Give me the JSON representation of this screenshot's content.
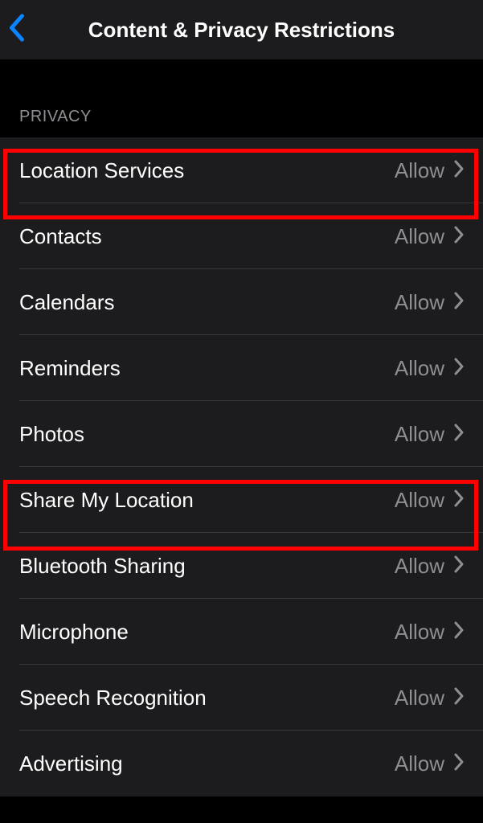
{
  "header": {
    "title": "Content & Privacy Restrictions"
  },
  "section": {
    "title": "PRIVACY",
    "items": [
      {
        "label": "Location Services",
        "value": "Allow"
      },
      {
        "label": "Contacts",
        "value": "Allow"
      },
      {
        "label": "Calendars",
        "value": "Allow"
      },
      {
        "label": "Reminders",
        "value": "Allow"
      },
      {
        "label": "Photos",
        "value": "Allow"
      },
      {
        "label": "Share My Location",
        "value": "Allow"
      },
      {
        "label": "Bluetooth Sharing",
        "value": "Allow"
      },
      {
        "label": "Microphone",
        "value": "Allow"
      },
      {
        "label": "Speech Recognition",
        "value": "Allow"
      },
      {
        "label": "Advertising",
        "value": "Allow"
      }
    ]
  }
}
